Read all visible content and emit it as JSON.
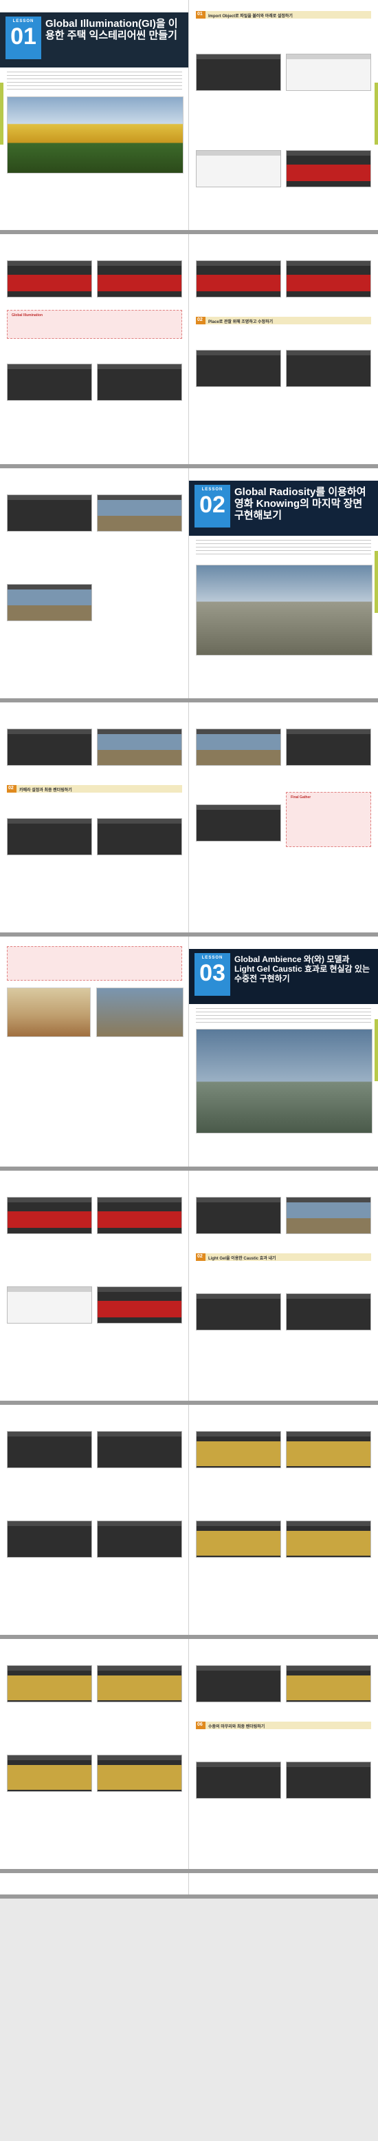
{
  "lessons": {
    "l1": {
      "label": "LESSON",
      "number": "01",
      "title": "Global Illumination(GI)을 이용한 주택 익스테리어씬 만들기"
    },
    "l2": {
      "label": "LESSON",
      "number": "02",
      "title": "Global Radiosity를 이용하여 영화 Knowing의 마지막 장면 구현해보기"
    },
    "l3": {
      "label": "LESSON",
      "number": "03",
      "title": "Global Ambience 와(와) 모델과 Light Gel Caustic 효과로 현실감 있는 수중전 구현하기"
    }
  },
  "sections": {
    "s1": {
      "num": "01",
      "title": "Import Object로 파일을 불러와 아래로 설정하기"
    },
    "s2": {
      "num": "02",
      "title": "Place로 관찰 위해 조명하고 수정하기"
    },
    "s3": {
      "num": "02",
      "title": "카메라 설정과 최종 렌더링하기"
    },
    "s4": {
      "num": "02",
      "title": "Light Gel을 이용한 Caustic 효과 내기"
    },
    "s5": {
      "num": "06",
      "title": "수중의 마무리와 최종 렌더링하기"
    }
  },
  "tips": {
    "t1": "Global Illumination",
    "t2": "Final Gather"
  }
}
